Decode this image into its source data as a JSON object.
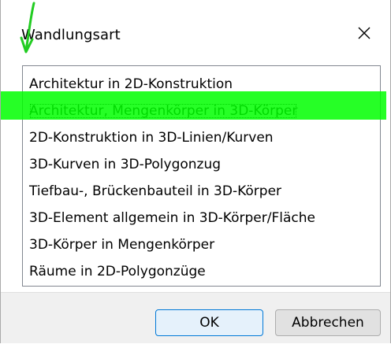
{
  "dialog": {
    "title": "Wandlungsart",
    "close_glyph": "✕"
  },
  "list": {
    "items": [
      "Architektur in 2D-Konstruktion",
      "Architektur, Mengenkörper in 3D-Körper",
      "2D-Konstruktion in 3D-Linien/Kurven",
      "3D-Kurven in 3D-Polygonzug",
      "Tiefbau-, Brückenbauteil in 3D-Körper",
      "3D-Element allgemein in 3D-Körper/Fläche",
      "3D-Körper in Mengenkörper",
      "Räume in 2D-Polygonzüge"
    ],
    "selected_index": 1
  },
  "buttons": {
    "ok_label": "OK",
    "cancel_label": "Abbrechen"
  },
  "colors": {
    "highlight": "#00ff00",
    "annotation_arrow": "#22cc22",
    "footer_bg": "#f0f0f0"
  },
  "icons": {
    "close": "close-icon",
    "annotation": "arrow-down-annotation-icon"
  }
}
